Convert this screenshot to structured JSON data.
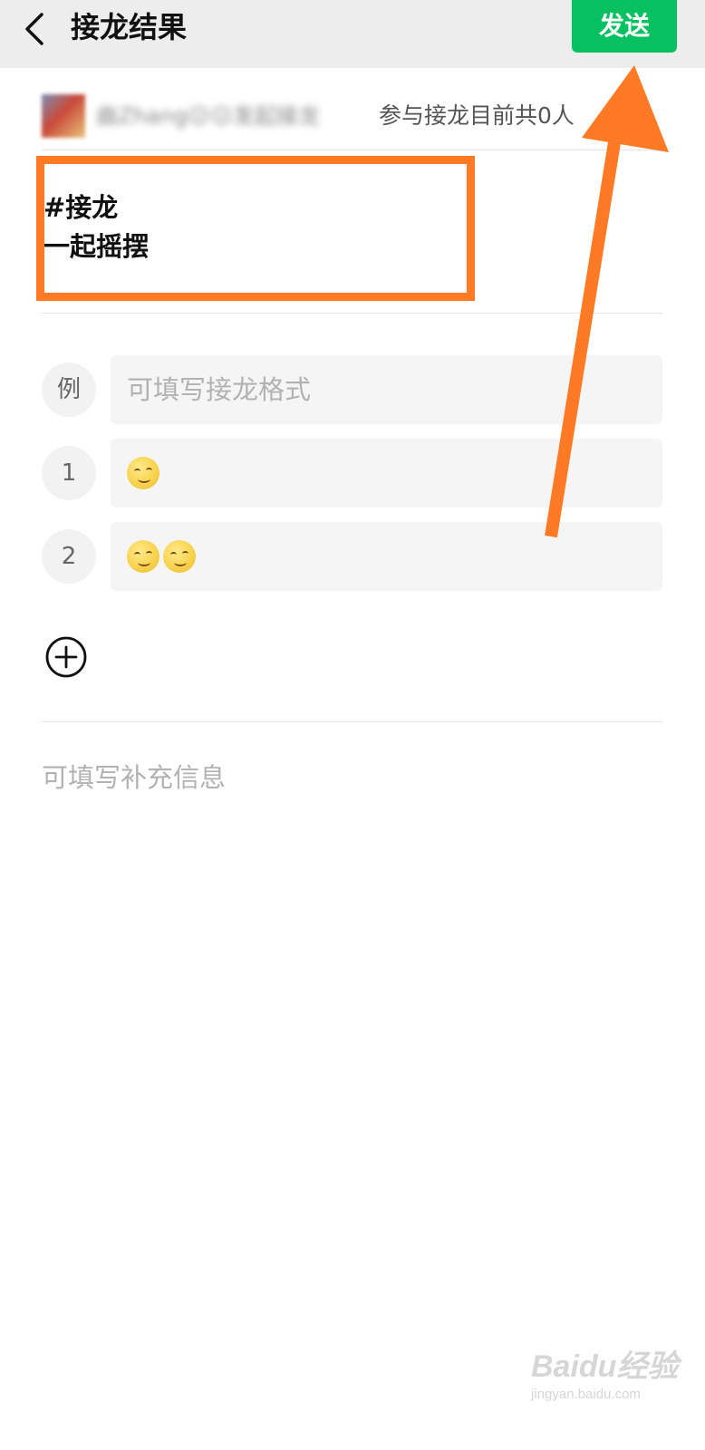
{
  "header": {
    "title": "接龙结果",
    "send_label": "发送"
  },
  "creator": {
    "name_blurred": "曲Zhang😐😐发起接龙",
    "participants_text": "参与接龙目前共0人"
  },
  "topic": {
    "line1": "#接龙",
    "line2": "一起摇摆"
  },
  "rows": [
    {
      "badge": "例",
      "value": "",
      "placeholder": "可填写接龙格式"
    },
    {
      "badge": "1",
      "value": "",
      "emoji_count": 1,
      "emoji_icon": "smirk-face-emoji"
    },
    {
      "badge": "2",
      "value": "",
      "emoji_count": 2,
      "emoji_icon": "smirk-face-emoji"
    }
  ],
  "extra_info": {
    "placeholder": "可填写补充信息"
  },
  "watermark": {
    "brand": "Baidu经验",
    "url": "jingyan.baidu.com"
  },
  "colors": {
    "header_bg": "#ededed",
    "send_button": "#07c160",
    "annotation_orange": "#ff7a24"
  },
  "icons": {
    "back": "chevron-left-icon",
    "add": "plus-circle-icon"
  }
}
